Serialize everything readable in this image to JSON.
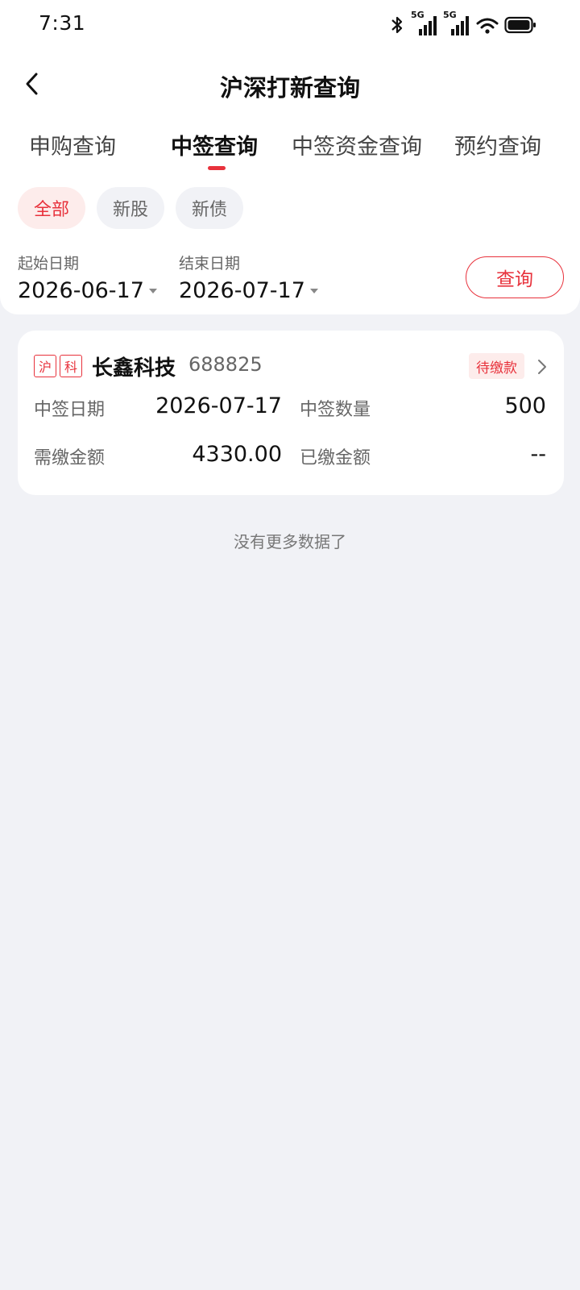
{
  "status_bar": {
    "time": "7:31",
    "network_1": "5G",
    "network_2": "5G",
    "icons": [
      "bluetooth-icon",
      "signal-icon",
      "signal-icon",
      "wifi-icon",
      "battery-icon"
    ]
  },
  "header": {
    "title": "沪深打新查询",
    "back_icon": "chevron-left-icon"
  },
  "tabs": [
    {
      "label": "申购查询",
      "active": false
    },
    {
      "label": "中签查询",
      "active": true
    },
    {
      "label": "中签资金查询",
      "active": false
    },
    {
      "label": "预约查询",
      "active": false
    }
  ],
  "filters": [
    {
      "label": "全部",
      "active": true
    },
    {
      "label": "新股",
      "active": false
    },
    {
      "label": "新债",
      "active": false
    }
  ],
  "date_range": {
    "start_label": "起始日期",
    "start_value": "2026-06-17",
    "end_label": "结束日期",
    "end_value": "2026-07-17",
    "query_label": "查询"
  },
  "records": [
    {
      "tags": [
        "沪",
        "科"
      ],
      "name": "长鑫科技",
      "code": "688825",
      "status": "待缴款",
      "fields": {
        "win_date_label": "中签日期",
        "win_date": "2026-07-17",
        "win_qty_label": "中签数量",
        "win_qty": "500",
        "due_label": "需缴金额",
        "due": "4330.00",
        "paid_label": "已缴金额",
        "paid": "--"
      }
    }
  ],
  "footer": {
    "no_more": "没有更多数据了"
  },
  "colors": {
    "accent": "#e8323c",
    "background": "#f1f2f6",
    "card": "#ffffff"
  }
}
